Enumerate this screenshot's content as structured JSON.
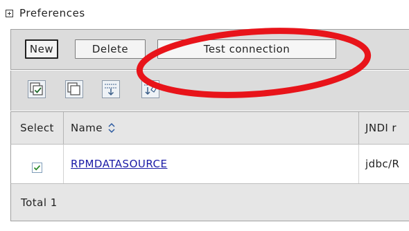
{
  "section": {
    "label": "Preferences"
  },
  "buttons": {
    "new": "New",
    "delete": "Delete",
    "test_connection": "Test connection"
  },
  "toolbar_icons": [
    "select-all-icon",
    "deselect-all-icon",
    "show-filter-icon",
    "clear-filter-icon"
  ],
  "table": {
    "columns": {
      "select": "Select",
      "name": "Name",
      "jndi": "JNDI r"
    },
    "rows": [
      {
        "selected": true,
        "name": "RPMDATASOURCE",
        "jndi": "jdbc/R"
      }
    ],
    "total_label": "Total 1"
  },
  "annotation": {
    "color": "#e8141a"
  }
}
